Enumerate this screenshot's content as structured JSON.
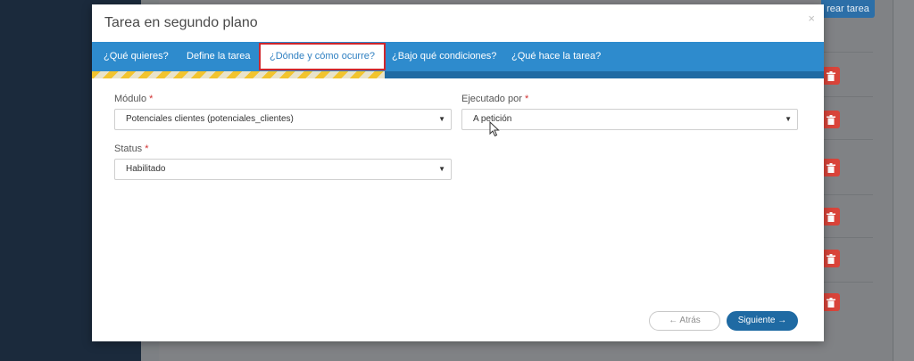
{
  "background": {
    "create_button_label": "rear tarea"
  },
  "modal": {
    "title": "Tarea en segundo plano",
    "close": "×"
  },
  "tabs": [
    {
      "label": "¿Qué quieres?"
    },
    {
      "label": "Define la tarea"
    },
    {
      "label": "¿Dónde y cómo ocurre?"
    },
    {
      "label": "¿Bajo qué condiciones?"
    },
    {
      "label": "¿Qué hace la tarea?"
    }
  ],
  "active_tab": "¿Dónde y cómo ocurre?",
  "progress": {
    "fraction": 0.4
  },
  "form": {
    "modulo": {
      "label": "Módulo",
      "required": "*",
      "value": "Potenciales clientes (potenciales_clientes)"
    },
    "ejecutado": {
      "label": "Ejecutado por",
      "required": "*",
      "value": "A petición"
    },
    "status": {
      "label": "Status",
      "required": "*",
      "value": "Habilitado"
    }
  },
  "footer": {
    "back_label": "← Atrás",
    "next_label": "Siguiente →"
  },
  "colors": {
    "tab_bar": "#2e8bcd",
    "active_tab_border": "#d0262c",
    "primary_button": "#1f6aa3",
    "delete_button": "#d9443a"
  }
}
